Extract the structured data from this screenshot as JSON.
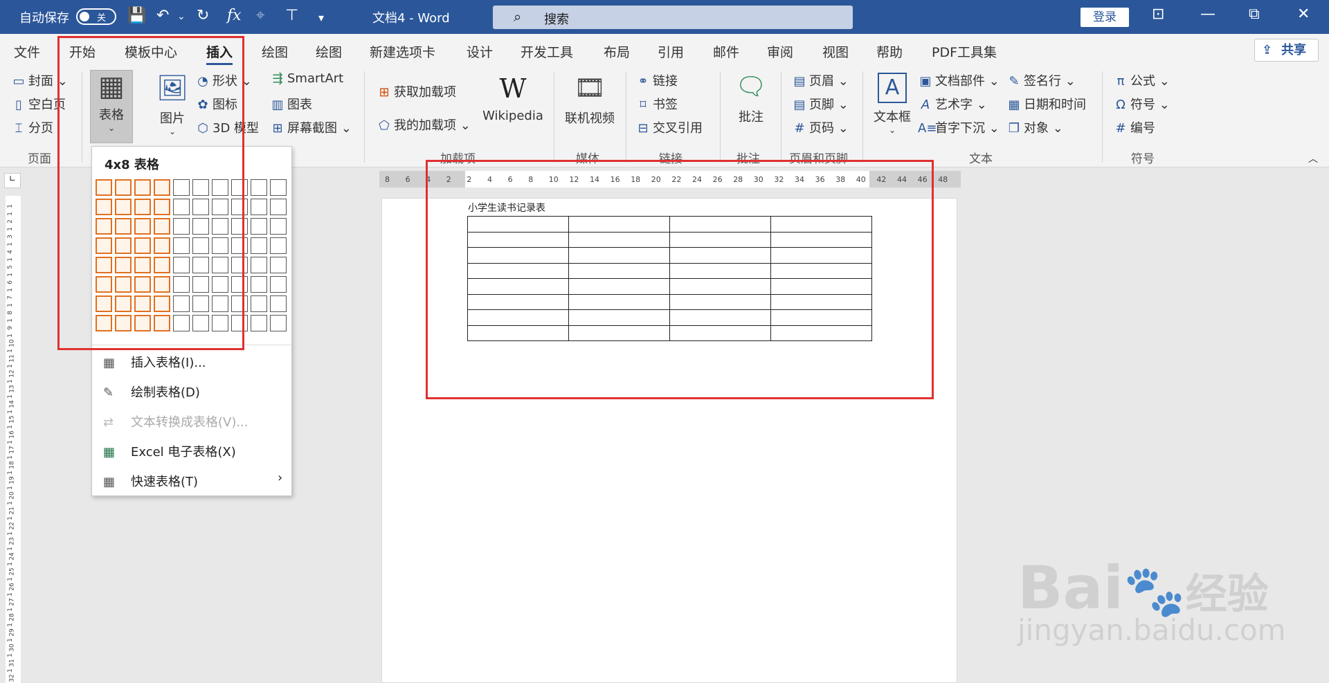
{
  "titlebar": {
    "autosave_label": "自动保存",
    "autosave_state": "关",
    "doc_title": "文档4 - Word",
    "search_placeholder": "搜索",
    "login_label": "登录"
  },
  "tabs": [
    "文件",
    "开始",
    "模板中心",
    "插入",
    "绘图",
    "绘图",
    "新建选项卡",
    "设计",
    "开发工具",
    "布局",
    "引用",
    "邮件",
    "审阅",
    "视图",
    "帮助",
    "PDF工具集"
  ],
  "active_tab": "插入",
  "share_label": "共享",
  "ribbon": {
    "pages": {
      "cover": "封面",
      "blank": "空白页",
      "break": "分页",
      "group": "页面"
    },
    "table": {
      "label": "表格"
    },
    "illustrations": {
      "picture": "图片",
      "shapes": "形状",
      "icons": "图标",
      "model3d": "3D 模型",
      "smartart": "SmartArt",
      "chart": "图表",
      "screenshot": "屏幕截图"
    },
    "addins": {
      "get": "获取加载项",
      "mine": "我的加载项",
      "wiki": "Wikipedia",
      "group": "加载项"
    },
    "media": {
      "video": "联机视频",
      "group": "媒体"
    },
    "links": {
      "link": "链接",
      "bookmark": "书签",
      "crossref": "交叉引用",
      "group": "链接"
    },
    "comments": {
      "comment": "批注",
      "group": "批注"
    },
    "headerfooter": {
      "header": "页眉",
      "footer": "页脚",
      "pagenum": "页码",
      "group": "页眉和页脚"
    },
    "text": {
      "textbox": "文本框",
      "quickparts": "文档部件",
      "wordart": "艺术字",
      "dropcap": "首字下沉",
      "sigline": "签名行",
      "datetime": "日期和时间",
      "object": "对象",
      "group": "文本"
    },
    "symbols": {
      "equation": "公式",
      "symbol": "符号",
      "number": "编号",
      "group": "符号"
    }
  },
  "ruler_labels": [
    "8",
    "6",
    "4",
    "2",
    "2",
    "4",
    "6",
    "8",
    "10",
    "12",
    "14",
    "16",
    "18",
    "20",
    "22",
    "24",
    "26",
    "28",
    "30",
    "32",
    "34",
    "36",
    "38",
    "40",
    "42",
    "44",
    "46",
    "48"
  ],
  "vruler_labels": [
    "1",
    "1",
    "2",
    "1",
    "3",
    "1",
    "4",
    "1",
    "5",
    "1",
    "6",
    "1",
    "7",
    "1",
    "8",
    "1",
    "9",
    "1",
    "10",
    "1",
    "11",
    "1",
    "12",
    "1",
    "13",
    "1",
    "14",
    "1",
    "15",
    "1",
    "16",
    "1",
    "17",
    "1",
    "18",
    "1",
    "19",
    "1",
    "20",
    "1",
    "21",
    "1",
    "22",
    "1",
    "23",
    "1",
    "24",
    "1",
    "25",
    "1",
    "26",
    "1",
    "27",
    "1",
    "28",
    "1",
    "29",
    "1",
    "30",
    "1",
    "31",
    "1",
    "32"
  ],
  "document": {
    "title": "小学生读书记录表",
    "table_cols": 4,
    "table_rows": 8
  },
  "dropdown": {
    "header": "4x8 表格",
    "grid_cols": 10,
    "grid_rows": 8,
    "sel_cols": 4,
    "sel_rows": 8,
    "items": [
      {
        "label": "插入表格(I)...",
        "disabled": false
      },
      {
        "label": "绘制表格(D)",
        "disabled": false
      },
      {
        "label": "文本转换成表格(V)...",
        "disabled": true
      },
      {
        "label": "Excel 电子表格(X)",
        "disabled": false
      },
      {
        "label": "快速表格(T)",
        "disabled": false
      }
    ]
  },
  "watermark": {
    "brand": "Bai",
    "cn": "经验",
    "url": "jingyan.baidu.com"
  },
  "colors": {
    "titlebar": "#2b579a",
    "highlight": "#e07020",
    "annotation": "#e03030"
  }
}
